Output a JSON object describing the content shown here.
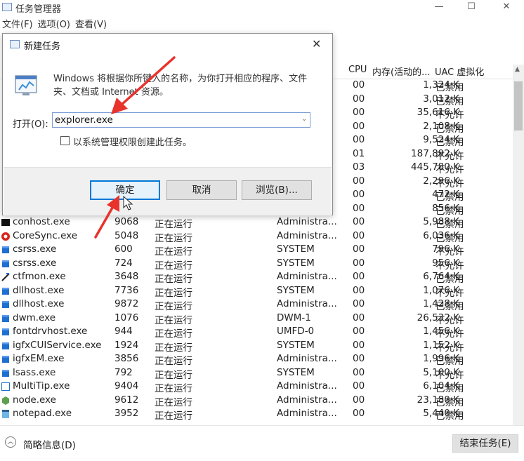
{
  "window": {
    "title": "任务管理器",
    "minimize": "—",
    "maximize": "☐",
    "close": "✕"
  },
  "menu": [
    "文件(F)",
    "选项(O)",
    "查看(V)"
  ],
  "columns": {
    "cpu": "CPU",
    "memory": "内存(活动的...",
    "uac": "UAC 虚拟化"
  },
  "partial_rows": [
    {
      "cpu": "00",
      "mem": "1,324 K",
      "uac": "已禁用"
    },
    {
      "cpu": "00",
      "mem": "3,012 K",
      "uac": "已禁用"
    },
    {
      "cpu": "00",
      "mem": "35,616 K",
      "uac": "不允许"
    },
    {
      "cpu": "00",
      "mem": "2,108 K",
      "uac": "已禁用"
    },
    {
      "cpu": "00",
      "mem": "9,524 K",
      "uac": "已禁用"
    },
    {
      "cpu": "01",
      "mem": "187,892 K",
      "uac": "不允许"
    },
    {
      "cpu": "03",
      "mem": "445,780 K",
      "uac": "不允许"
    },
    {
      "cpu": "00",
      "mem": "2,296 K",
      "uac": "不允许"
    },
    {
      "cpu": "00",
      "mem": "472 K",
      "uac": "已禁用"
    },
    {
      "cpu": "00",
      "mem": "856 K",
      "uac": "已禁用"
    }
  ],
  "rows": [
    {
      "name": "conhost.exe",
      "pid": "9068",
      "status": "正在运行",
      "user": "Administra...",
      "cpu": "00",
      "mem": "5,988 K",
      "uac": "已禁用",
      "icon": "console-icon"
    },
    {
      "name": "CoreSync.exe",
      "pid": "5048",
      "status": "正在运行",
      "user": "Administra...",
      "cpu": "00",
      "mem": "6,036 K",
      "uac": "已禁用",
      "icon": "coresync-icon"
    },
    {
      "name": "csrss.exe",
      "pid": "600",
      "status": "正在运行",
      "user": "SYSTEM",
      "cpu": "00",
      "mem": "796 K",
      "uac": "不允许",
      "icon": "app-icon"
    },
    {
      "name": "csrss.exe",
      "pid": "724",
      "status": "正在运行",
      "user": "SYSTEM",
      "cpu": "00",
      "mem": "956 K",
      "uac": "不允许",
      "icon": "app-icon"
    },
    {
      "name": "ctfmon.exe",
      "pid": "3648",
      "status": "正在运行",
      "user": "Administra...",
      "cpu": "00",
      "mem": "6,764 K",
      "uac": "已禁用",
      "icon": "pen-icon"
    },
    {
      "name": "dllhost.exe",
      "pid": "7736",
      "status": "正在运行",
      "user": "SYSTEM",
      "cpu": "00",
      "mem": "1,076 K",
      "uac": "不允许",
      "icon": "app-icon"
    },
    {
      "name": "dllhost.exe",
      "pid": "9872",
      "status": "正在运行",
      "user": "Administra...",
      "cpu": "00",
      "mem": "1,428 K",
      "uac": "已禁用",
      "icon": "app-icon"
    },
    {
      "name": "dwm.exe",
      "pid": "1076",
      "status": "正在运行",
      "user": "DWM-1",
      "cpu": "00",
      "mem": "26,532 K",
      "uac": "不允许",
      "icon": "app-icon"
    },
    {
      "name": "fontdrvhost.exe",
      "pid": "944",
      "status": "正在运行",
      "user": "UMFD-0",
      "cpu": "00",
      "mem": "1,456 K",
      "uac": "不允许",
      "icon": "app-icon"
    },
    {
      "name": "igfxCUIService.exe",
      "pid": "1924",
      "status": "正在运行",
      "user": "SYSTEM",
      "cpu": "00",
      "mem": "1,152 K",
      "uac": "不允许",
      "icon": "app-icon"
    },
    {
      "name": "igfxEM.exe",
      "pid": "3856",
      "status": "正在运行",
      "user": "Administra...",
      "cpu": "00",
      "mem": "1,996 K",
      "uac": "已禁用",
      "icon": "app-icon"
    },
    {
      "name": "lsass.exe",
      "pid": "792",
      "status": "正在运行",
      "user": "SYSTEM",
      "cpu": "00",
      "mem": "5,100 K",
      "uac": "不允许",
      "icon": "app-icon"
    },
    {
      "name": "MultiTip.exe",
      "pid": "9404",
      "status": "正在运行",
      "user": "Administra...",
      "cpu": "00",
      "mem": "6,104 K",
      "uac": "已禁用",
      "icon": "window-icon"
    },
    {
      "name": "node.exe",
      "pid": "9612",
      "status": "正在运行",
      "user": "Administra...",
      "cpu": "00",
      "mem": "23,180 K",
      "uac": "已禁用",
      "icon": "node-icon"
    },
    {
      "name": "notepad.exe",
      "pid": "3952",
      "status": "正在运行",
      "user": "Administra...",
      "cpu": "00",
      "mem": "5,440 K",
      "uac": "已禁用",
      "icon": "notepad-icon"
    }
  ],
  "footer": {
    "less_details": "简略信息(D)",
    "end_task": "结束任务(E)"
  },
  "dialog": {
    "title": "新建任务",
    "close": "✕",
    "description": "Windows 将根据你所键入的名称，为你打开相应的程序、文件夹、文档或 Internet 资源。",
    "open_label": "打开(O):",
    "open_value": "explorer.exe",
    "admin_checkbox": "以系统管理权限创建此任务。",
    "ok": "确定",
    "cancel": "取消",
    "browse": "浏览(B)..."
  },
  "colors": {
    "accent": "#0078d7",
    "annotation": "#e8322c"
  }
}
